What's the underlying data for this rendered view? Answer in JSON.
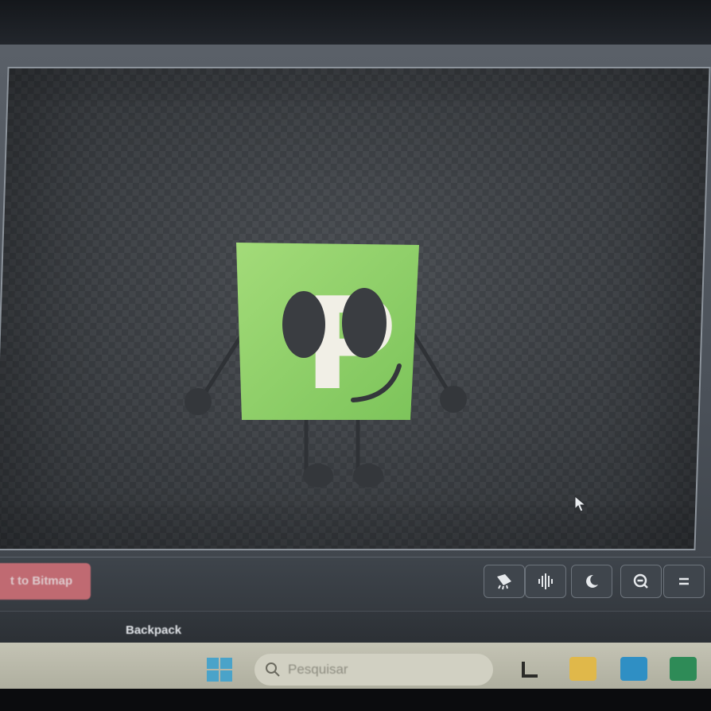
{
  "toolbar": {
    "convert_button_label": "t to Bitmap",
    "tool_buttons": [
      {
        "icon": "brush-icon"
      },
      {
        "icon": "sound-wave-icon"
      },
      {
        "icon": "moon-icon"
      },
      {
        "icon": "zoom-out-icon"
      },
      {
        "icon": "equals-icon"
      }
    ]
  },
  "backpack": {
    "label": "Backpack"
  },
  "taskbar": {
    "search_placeholder": "Pesquisar",
    "apps": [
      "start-icon",
      "search-icon",
      "snap-icon",
      "file-explorer-icon",
      "store-icon",
      "excel-icon"
    ]
  },
  "character": {
    "letter": "P"
  },
  "colors": {
    "accent": "#d8727a",
    "character_green": "#8fd06a",
    "canvas_bg": "#3b3f44",
    "limb_color": "#3a3d42"
  }
}
